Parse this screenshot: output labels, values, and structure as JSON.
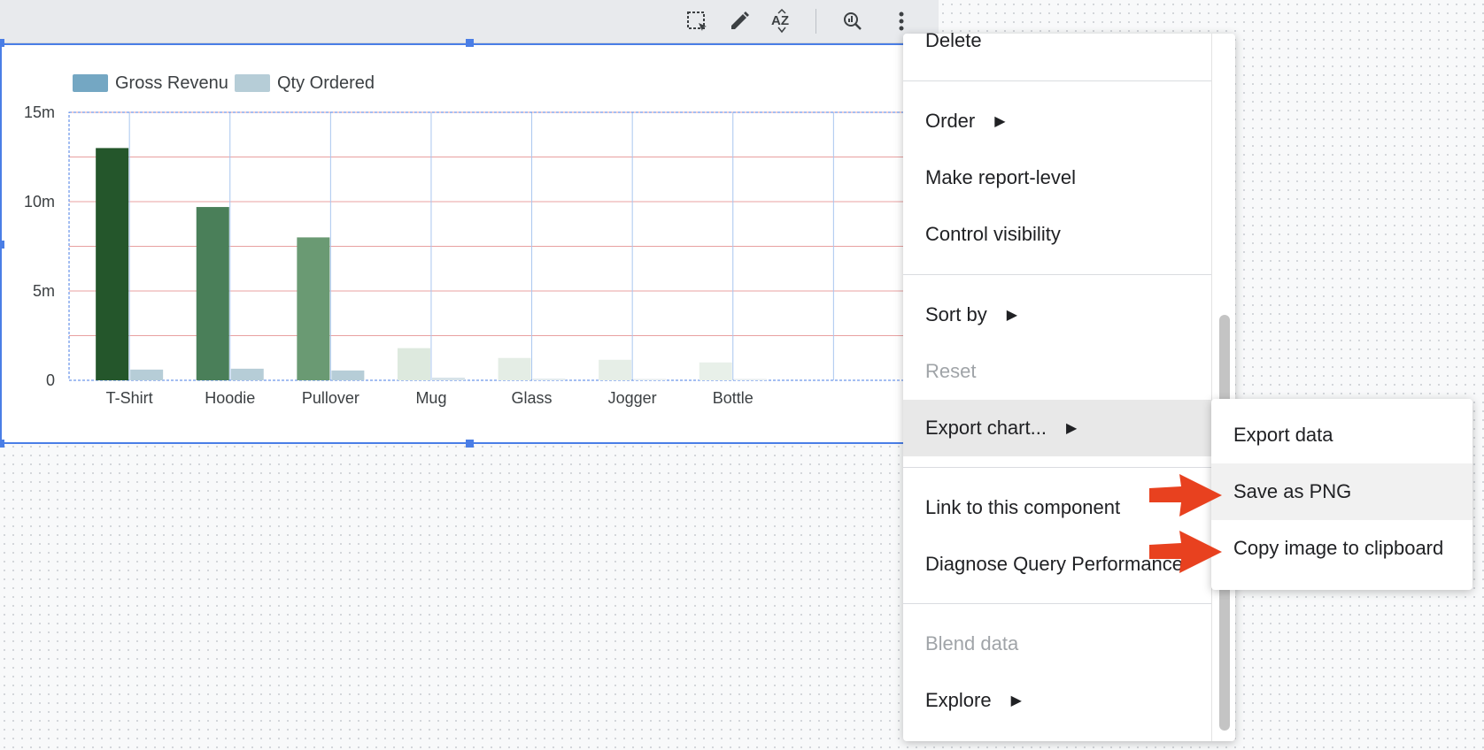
{
  "toolbar": {
    "icons": [
      "select-area-icon",
      "edit-pencil-icon",
      "sort-az-icon",
      "query-performance-icon",
      "more-vert-icon"
    ]
  },
  "chart_data": {
    "type": "bar",
    "legend": [
      "Gross Revenu",
      "Qty Ordered"
    ],
    "legend_position": "top-left",
    "categories": [
      "T-Shirt",
      "Hoodie",
      "Pullover",
      "Mug",
      "Glass",
      "Jogger",
      "Bottle"
    ],
    "series": [
      {
        "name": "Gross Revenu",
        "values": [
          13,
          9.7,
          8,
          1.8,
          1.25,
          1.15,
          1.0
        ],
        "colors": [
          "#24562b",
          "#4a7f59",
          "#6a9a73",
          "#dde9de",
          "#e4ede5",
          "#e6eee7",
          "#e8f0e9"
        ]
      },
      {
        "name": "Qty Ordered",
        "values": [
          0.6,
          0.65,
          0.55,
          0.15,
          0.1,
          0.08,
          0.08
        ],
        "colors": [
          "#b6cdd7",
          "#b6cdd7",
          "#b6cdd7",
          "#d7e3e9",
          "#e3ebef",
          "#e6edf1",
          "#e6edf1"
        ]
      }
    ],
    "yticks": [
      "0",
      "5m",
      "10m",
      "15m"
    ],
    "ylim": [
      0,
      15
    ],
    "grid": true
  },
  "menu": {
    "items": [
      {
        "label": "Delete",
        "disabled": false,
        "submenu": false
      },
      {
        "label": "Order",
        "disabled": false,
        "submenu": true
      },
      {
        "label": "Make report-level",
        "disabled": false,
        "submenu": false
      },
      {
        "label": "Control visibility",
        "disabled": false,
        "submenu": false
      },
      {
        "label": "Sort by",
        "disabled": false,
        "submenu": true
      },
      {
        "label": "Reset",
        "disabled": true,
        "submenu": false
      },
      {
        "label": "Export chart...",
        "disabled": false,
        "submenu": true
      },
      {
        "label": "Link to this component",
        "disabled": false,
        "submenu": false
      },
      {
        "label": "Diagnose Query Performance",
        "disabled": false,
        "submenu": false
      },
      {
        "label": "Blend data",
        "disabled": true,
        "submenu": false
      },
      {
        "label": "Explore",
        "disabled": false,
        "submenu": true
      }
    ]
  },
  "submenu": {
    "items": [
      {
        "label": "Export data"
      },
      {
        "label": "Save as PNG"
      },
      {
        "label": "Copy image to clipboard"
      }
    ]
  },
  "colors": {
    "selection": "#4a7ee6",
    "annotation_arrow": "#e8411f",
    "grid_red": "#e8a0a0",
    "grid_blue": "#a9c6ef"
  }
}
